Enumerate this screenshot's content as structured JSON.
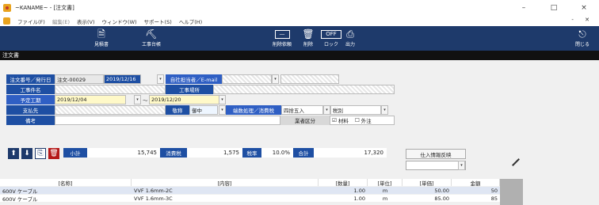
{
  "window": {
    "title": "~KANAME~ - [注文書]",
    "controls": [
      "–",
      "□",
      "×"
    ]
  },
  "menu": {
    "items": [
      "ファイル(F)",
      "編集(E)",
      "表示(V)",
      "ウィンドウ(W)",
      "サポート(S)",
      "ヘルプ(H)"
    ],
    "mdi_controls": "- ✕"
  },
  "toolbar": {
    "estimate": "見積書",
    "ledger": "工事台帳",
    "delete_request": "削除依頼",
    "delete": "削除",
    "lock": "ロック",
    "lock_state": "OFF",
    "output": "出力",
    "close": "閉じる"
  },
  "section": {
    "title": "注文書"
  },
  "form": {
    "order_no_label": "注文番号／発行日",
    "order_no": "注文-00029",
    "issue_date": "2019/12/16",
    "staff_label": "自社担当者／E-mail",
    "project_label": "工事件名",
    "site_label": "工事場所",
    "period_label": "予定工期",
    "period_start": "2019/12/04",
    "period_sep": "～",
    "period_end": "2019/12/20",
    "payee_label": "支払先",
    "honorific_label": "敬称",
    "honorific": "御中",
    "rounding_label": "端数処理／消費税",
    "rounding": "四捨五入",
    "tax_mode": "税別",
    "note_label": "備考",
    "business_label": "業者区分",
    "material_label": "材料",
    "outsource_label": "外注",
    "material_check": "☑",
    "outsource_check": "☐"
  },
  "summary": {
    "subtotal_label": "小計",
    "subtotal": "15,745",
    "tax_label": "消費税",
    "tax": "1,575",
    "rate_label": "税率",
    "rate": "10.0%",
    "total_label": "合計",
    "total": "17,320"
  },
  "reflect": {
    "label": "仕入情報反映"
  },
  "grid": {
    "headers": [
      "[名称]",
      "[内容]",
      "[数量]",
      "[単位]",
      "[単価]",
      "金額"
    ],
    "rows": [
      {
        "name": "600V ケーブル",
        "content": "VVF 1.6mm-2C",
        "qty": "1.00",
        "unit": "m",
        "price": "50.00",
        "amount": "50"
      },
      {
        "name": "600V ケーブル",
        "content": "VVF 1.6mm-3C",
        "qty": "1.00",
        "unit": "m",
        "price": "85.00",
        "amount": "85"
      }
    ]
  },
  "colors": {
    "navy": "#1e3a6b",
    "blue": "#1e4fa3",
    "accent_red": "#b51818"
  }
}
